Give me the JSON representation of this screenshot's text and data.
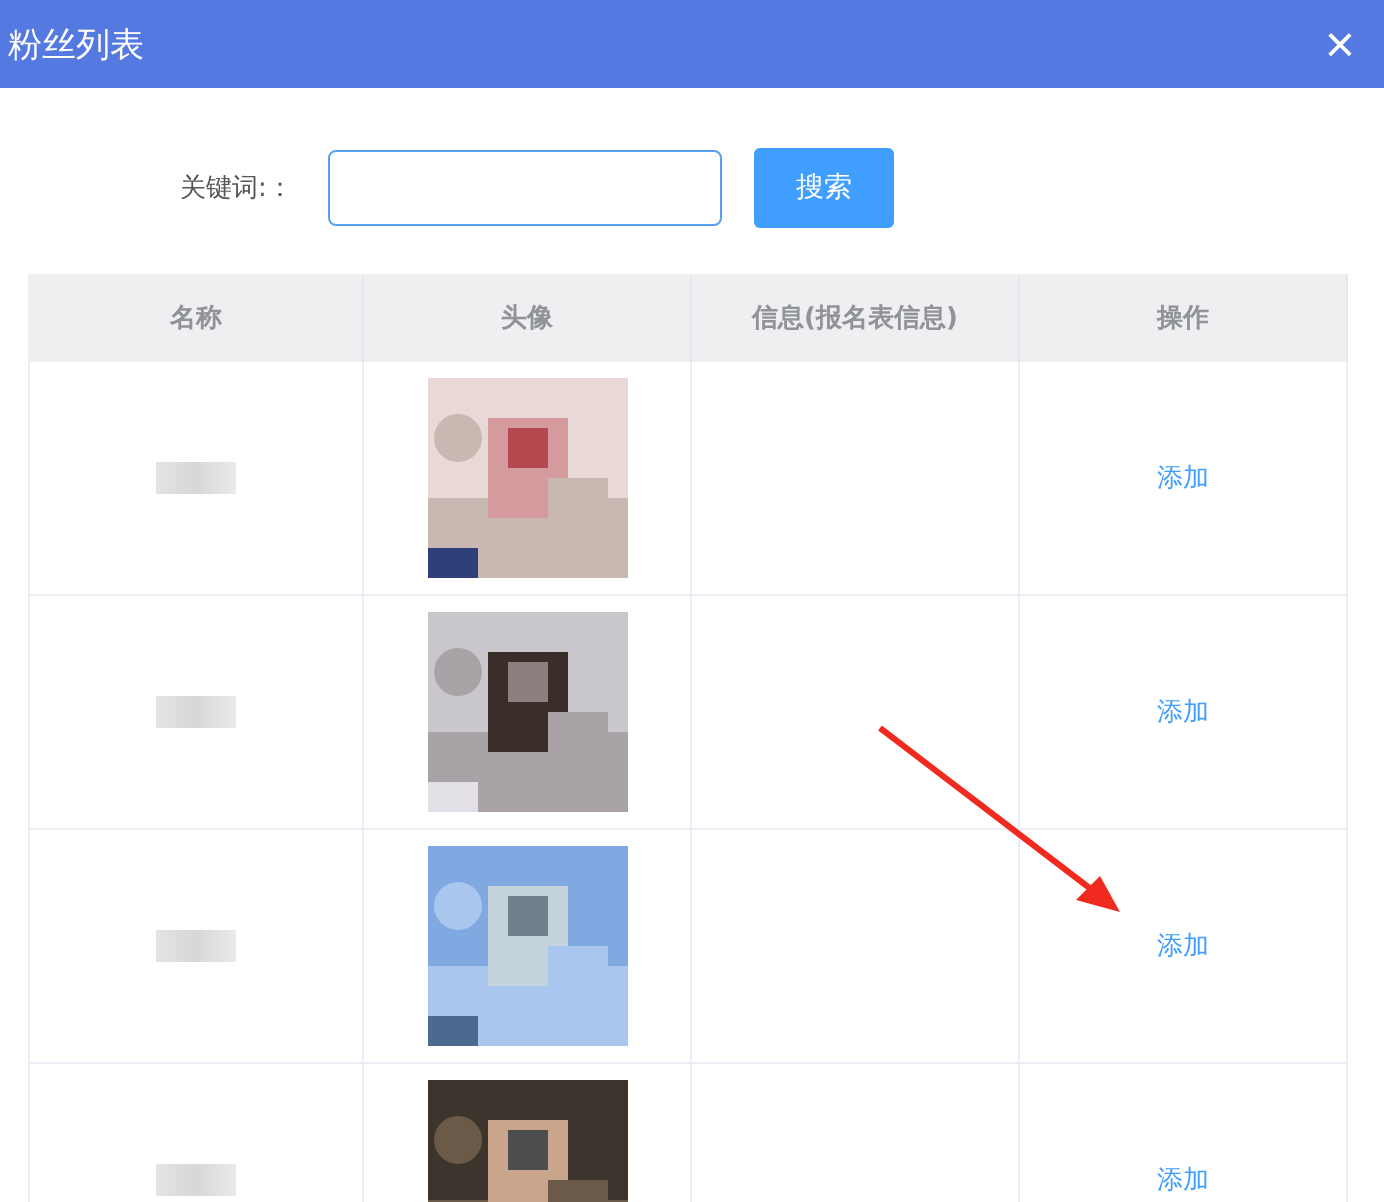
{
  "dialog": {
    "title": "粉丝列表",
    "close": "×"
  },
  "search": {
    "label": "关键词:：",
    "button": "搜索"
  },
  "table": {
    "columns": [
      "名称",
      "头像",
      "信息(报名表信息)",
      "操作"
    ],
    "rows": [
      {
        "action": "添加"
      },
      {
        "action": "添加"
      },
      {
        "action": "添加"
      },
      {
        "action": "添加"
      }
    ]
  }
}
